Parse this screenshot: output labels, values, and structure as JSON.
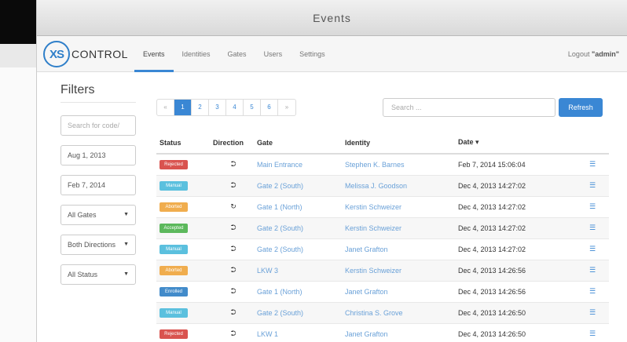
{
  "window": {
    "title": "Events"
  },
  "logo": {
    "mark": "XS",
    "text": "CONTROL"
  },
  "nav": {
    "tabs": [
      {
        "label": "Events"
      },
      {
        "label": "Identities"
      },
      {
        "label": "Gates"
      },
      {
        "label": "Users"
      },
      {
        "label": "Settings"
      }
    ],
    "logout_prefix": "Logout ",
    "logout_user": "\"admin\""
  },
  "filters": {
    "title": "Filters",
    "code_placeholder": "Search for code/",
    "date_from": "Aug 1, 2013",
    "date_to": "Feb 7, 2014",
    "gates": "All Gates",
    "directions": "Both Directions",
    "status": "All Status"
  },
  "pager": {
    "prev": "«",
    "pages": [
      "1",
      "2",
      "3",
      "4",
      "5",
      "6"
    ],
    "next": "»",
    "active": "1"
  },
  "search": {
    "placeholder": "Search ..."
  },
  "refresh_label": "Refresh",
  "table": {
    "headers": {
      "status": "Status",
      "direction": "Direction",
      "gate": "Gate",
      "identity": "Identity",
      "date": "Date ▾"
    },
    "rows": [
      {
        "status": "Rejected",
        "color": "#d9534f",
        "dir": "⮊",
        "gate": "Main Entrance",
        "identity": "Stephen K. Barnes",
        "date": "Feb 7, 2014 15:06:04"
      },
      {
        "status": "Manual",
        "color": "#5bc0de",
        "dir": "⮊",
        "gate": "Gate 2 (South)",
        "identity": "Melissa J. Goodson",
        "date": "Dec 4, 2013 14:27:02"
      },
      {
        "status": "Aborted",
        "color": "#f0ad4e",
        "dir": "↻",
        "gate": "Gate 1 (North)",
        "identity": "Kerstin Schweizer",
        "date": "Dec 4, 2013 14:27:02"
      },
      {
        "status": "Accepted",
        "color": "#5cb85c",
        "dir": "⮊",
        "gate": "Gate 2 (South)",
        "identity": "Kerstin Schweizer",
        "date": "Dec 4, 2013 14:27:02"
      },
      {
        "status": "Manual",
        "color": "#5bc0de",
        "dir": "⮊",
        "gate": "Gate 2 (South)",
        "identity": "Janet Grafton",
        "date": "Dec 4, 2013 14:27:02"
      },
      {
        "status": "Aborted",
        "color": "#f0ad4e",
        "dir": "⮊",
        "gate": "LKW 3",
        "identity": "Kerstin Schweizer",
        "date": "Dec 4, 2013 14:26:56"
      },
      {
        "status": "Enrolled",
        "color": "#428bca",
        "dir": "⮊",
        "gate": "Gate 1 (North)",
        "identity": "Janet Grafton",
        "date": "Dec 4, 2013 14:26:56"
      },
      {
        "status": "Manual",
        "color": "#5bc0de",
        "dir": "⮊",
        "gate": "Gate 2 (South)",
        "identity": "Christina S. Grove",
        "date": "Dec 4, 2013 14:26:50"
      },
      {
        "status": "Rejected",
        "color": "#d9534f",
        "dir": "⮊",
        "gate": "LKW 1",
        "identity": "Janet Grafton",
        "date": "Dec 4, 2013 14:26:50"
      }
    ]
  }
}
